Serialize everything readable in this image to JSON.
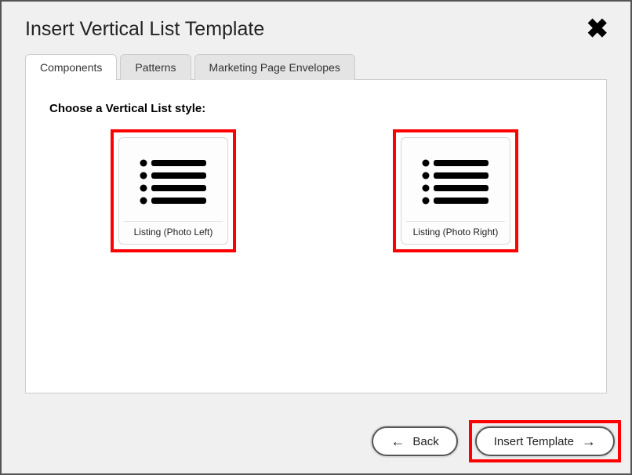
{
  "dialog": {
    "title": "Insert Vertical List Template"
  },
  "tabs": {
    "items": [
      {
        "label": "Components",
        "active": true
      },
      {
        "label": "Patterns",
        "active": false
      },
      {
        "label": "Marketing Page Envelopes",
        "active": false
      }
    ]
  },
  "panel": {
    "choose_label": "Choose a Vertical List style:",
    "options": [
      {
        "label": "Listing (Photo Left)"
      },
      {
        "label": "Listing (Photo Right)"
      }
    ]
  },
  "footer": {
    "back_label": "Back",
    "insert_label": "Insert Template"
  }
}
